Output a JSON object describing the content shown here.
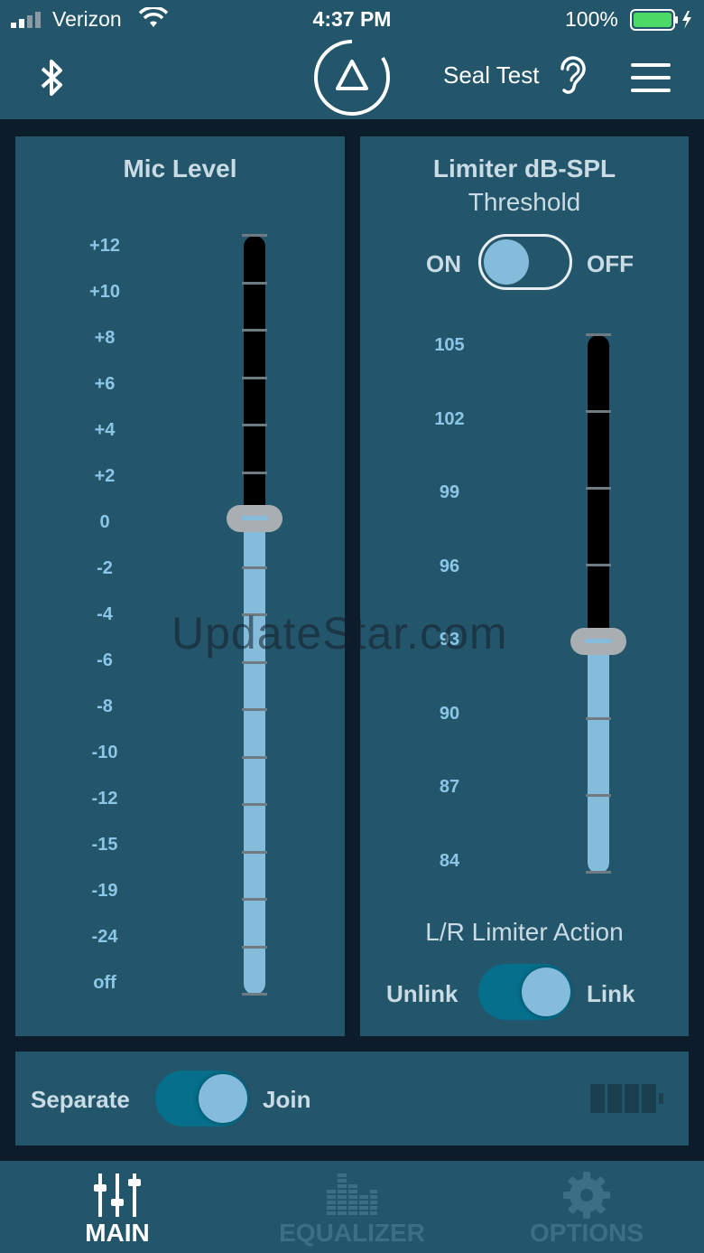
{
  "status_bar": {
    "carrier": "Verizon",
    "time": "4:37 PM",
    "battery_percent": "100%"
  },
  "header": {
    "seal_test_label": "Seal Test"
  },
  "mic_panel": {
    "title": "Mic Level",
    "scale": [
      "+12",
      "+10",
      "+8",
      "+6",
      "+4",
      "+2",
      "0",
      "-2",
      "-4",
      "-6",
      "-8",
      "-10",
      "-12",
      "-15",
      "-19",
      "-24",
      "off"
    ],
    "value": "0"
  },
  "limiter_panel": {
    "title": "Limiter dB-SPL",
    "subtitle": "Threshold",
    "toggle_on_label": "ON",
    "toggle_off_label": "OFF",
    "scale": [
      "105",
      "102",
      "99",
      "96",
      "93",
      "90",
      "87",
      "84"
    ],
    "value": "93",
    "action_label": "L/R Limiter Action",
    "unlink_label": "Unlink",
    "link_label": "Link"
  },
  "bottom_panel": {
    "separate_label": "Separate",
    "join_label": "Join"
  },
  "watermark": "UpdateStar.com",
  "tabs": [
    {
      "label": "MAIN",
      "icon": "sliders-icon",
      "active": true
    },
    {
      "label": "EQUALIZER",
      "icon": "equalizer-icon",
      "active": false
    },
    {
      "label": "OPTIONS",
      "icon": "gear-icon",
      "active": false
    }
  ],
  "colors": {
    "panel": "#24566b",
    "background": "#0d1c2a",
    "accent": "#85bcdc",
    "switch_on": "#056f8c",
    "battery": "#4cd964"
  }
}
